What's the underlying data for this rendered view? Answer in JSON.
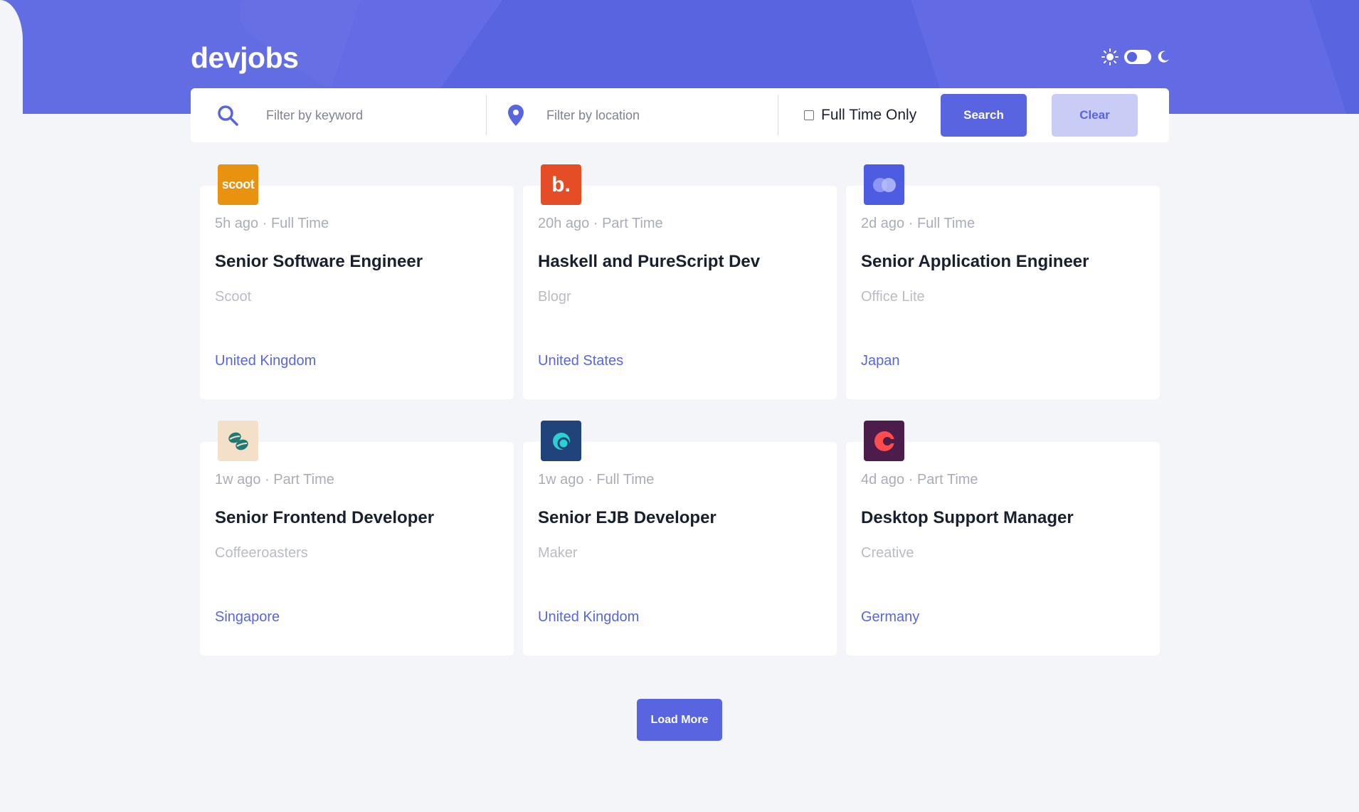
{
  "app": {
    "logo_text": "devjobs"
  },
  "theme": {
    "mode": "light"
  },
  "filters": {
    "keyword_placeholder": "Filter by keyword",
    "location_placeholder": "Filter by location",
    "fulltime_label": "Full Time Only",
    "search_label": "Search",
    "clear_label": "Clear"
  },
  "jobs": [
    {
      "posted": "5h ago",
      "contract": "Full Time",
      "title": "Senior Software Engineer",
      "company": "Scoot",
      "location": "United Kingdom",
      "logo_text": "scoot",
      "logo_color": "#e99210"
    },
    {
      "posted": "20h ago",
      "contract": "Part Time",
      "title": "Haskell and PureScript Dev",
      "company": "Blogr",
      "location": "United States",
      "logo_text": "b.",
      "logo_color": "#e54d26"
    },
    {
      "posted": "2d ago",
      "contract": "Full Time",
      "title": "Senior Application Engineer",
      "company": "Office Lite",
      "location": "Japan",
      "logo_text": "",
      "logo_color": "#4e5ce2"
    },
    {
      "posted": "1w ago",
      "contract": "Part Time",
      "title": "Senior Frontend Developer",
      "company": "Coffeeroasters",
      "location": "Singapore",
      "logo_text": "",
      "logo_color": "#f4dfc8"
    },
    {
      "posted": "1w ago",
      "contract": "Full Time",
      "title": "Senior EJB Developer",
      "company": "Maker",
      "location": "United Kingdom",
      "logo_text": "",
      "logo_color": "#21437b"
    },
    {
      "posted": "4d ago",
      "contract": "Part Time",
      "title": "Desktop Support Manager",
      "company": "Creative",
      "location": "Germany",
      "logo_text": "",
      "logo_color": "#4c1c4a"
    }
  ],
  "meta_separator": "·",
  "load_more_label": "Load More",
  "colors": {
    "accent": "#5964e0",
    "accent_light": "#c9ccf5",
    "text_dark": "#19202d",
    "text_muted": "#a9adb8"
  }
}
